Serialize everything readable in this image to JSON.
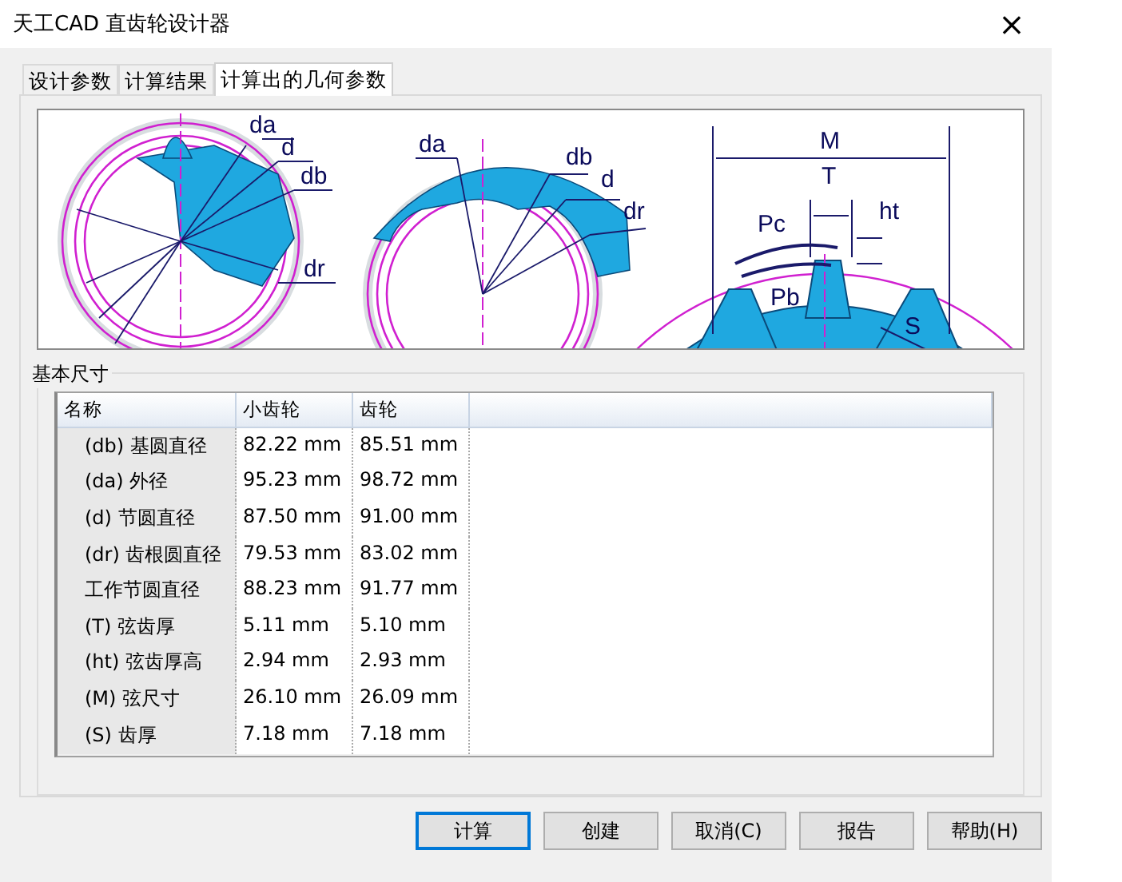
{
  "window": {
    "title": "天工CAD 直齿轮设计器",
    "close": "×"
  },
  "tabs": [
    {
      "label": "设计参数",
      "selected": false
    },
    {
      "label": "计算结果",
      "selected": false
    },
    {
      "label": "计算出的几何参数",
      "selected": true
    }
  ],
  "diagrams": [
    {
      "labels": [
        "da",
        "d",
        "db",
        "dr"
      ]
    },
    {
      "labels": [
        "da",
        "db",
        "d",
        "dr"
      ]
    },
    {
      "labels": [
        "M",
        "T",
        "ht",
        "Pc",
        "Pb",
        "S"
      ]
    }
  ],
  "group": {
    "title": "基本尺寸"
  },
  "table": {
    "columns": [
      "名称",
      "小齿轮",
      "齿轮"
    ],
    "rows": [
      {
        "name": "(db) 基圆直径",
        "pinion": "82.22 mm",
        "gear": "85.51 mm"
      },
      {
        "name": "(da) 外径",
        "pinion": "95.23 mm",
        "gear": "98.72 mm"
      },
      {
        "name": "(d) 节圆直径",
        "pinion": "87.50 mm",
        "gear": "91.00 mm"
      },
      {
        "name": "(dr) 齿根圆直径",
        "pinion": "79.53 mm",
        "gear": "83.02 mm"
      },
      {
        "name": "工作节圆直径",
        "pinion": "88.23 mm",
        "gear": "91.77 mm"
      },
      {
        "name": "(T) 弦齿厚",
        "pinion": "5.11 mm",
        "gear": "5.10 mm"
      },
      {
        "name": "(ht) 弦齿厚高",
        "pinion": "2.94 mm",
        "gear": "2.93 mm"
      },
      {
        "name": "(M) 弦尺寸",
        "pinion": "26.10 mm",
        "gear": "26.09 mm"
      },
      {
        "name": "(S) 齿厚",
        "pinion": "7.18 mm",
        "gear": "7.18 mm"
      }
    ]
  },
  "buttons": [
    {
      "label": "计算",
      "default": true
    },
    {
      "label": "创建",
      "default": false
    },
    {
      "label": "取消(C)",
      "default": false
    },
    {
      "label": "报告",
      "default": false
    },
    {
      "label": "帮助(H)",
      "default": false
    }
  ]
}
